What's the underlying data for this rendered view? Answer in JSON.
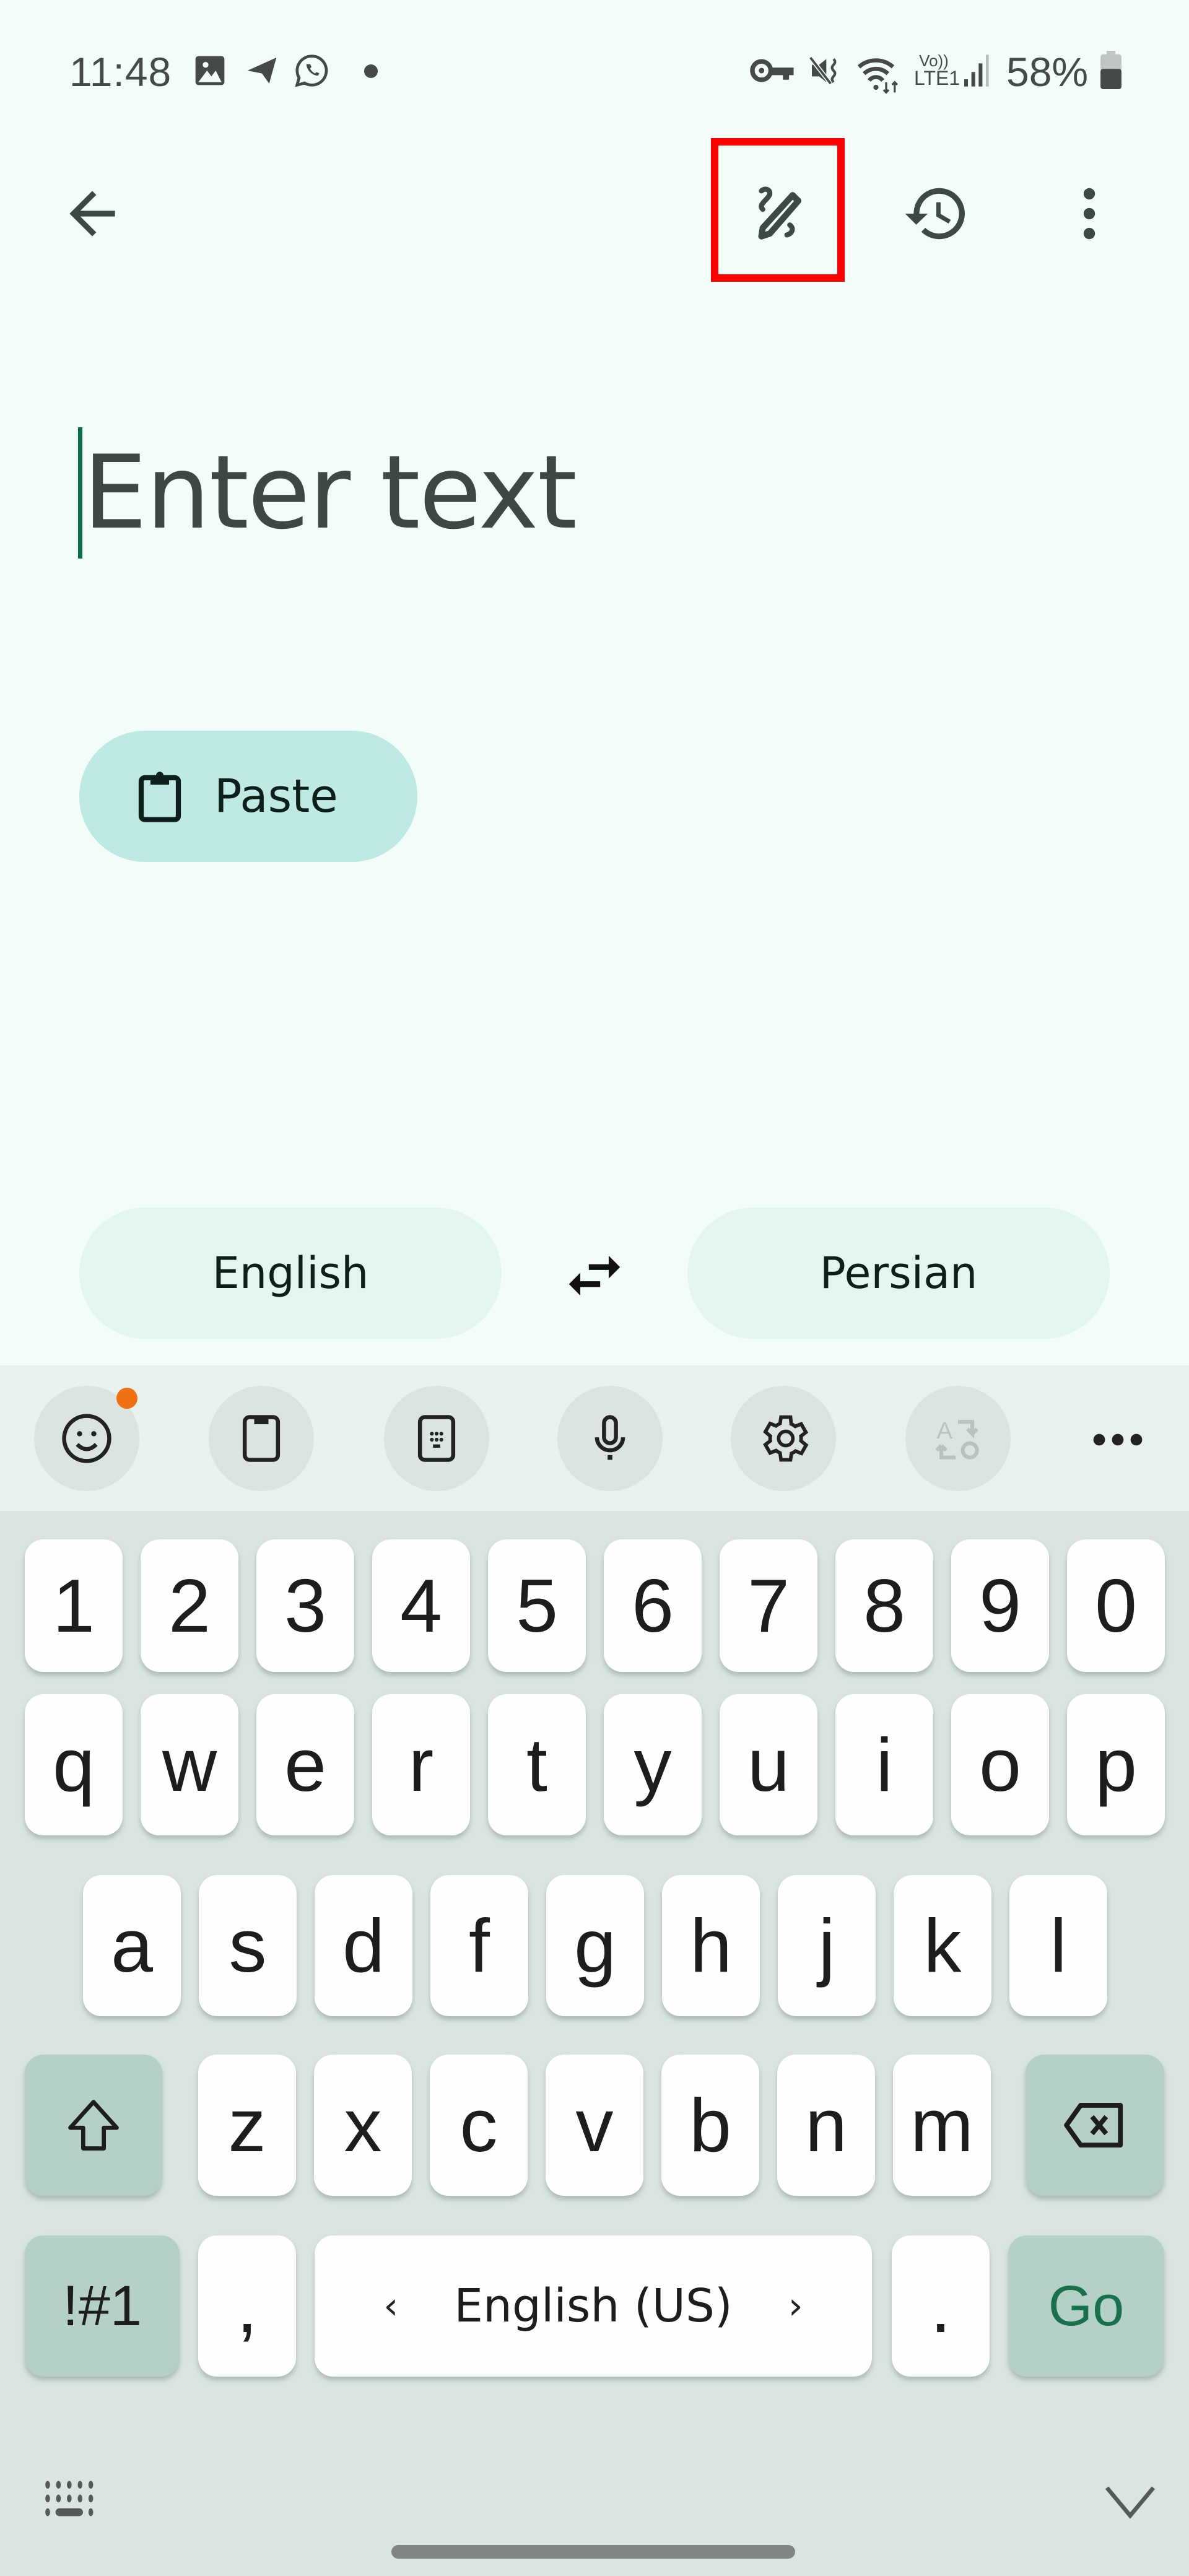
{
  "status_bar": {
    "time": "11:48",
    "left_icons": [
      "gallery-icon",
      "telegram-icon",
      "whatsapp-icon",
      "dot-icon"
    ],
    "right_icons": [
      "vpn-key-icon",
      "mute-vibrate-icon",
      "wifi-icon",
      "volte-lte-icon",
      "signal-icon"
    ],
    "volte_label_top": "Vo))",
    "volte_label_bottom": "LTE1",
    "battery": "58%",
    "battery_level": 0.58
  },
  "app_bar": {
    "back": "back-icon",
    "actions": [
      "handwriting-icon",
      "history-icon",
      "more-vert-icon"
    ],
    "highlighted_action": "handwriting-icon"
  },
  "input": {
    "placeholder": "Enter text",
    "value": ""
  },
  "paste_button": {
    "label": "Paste"
  },
  "languages": {
    "source": "English",
    "target": "Persian"
  },
  "keyboard": {
    "toolbar": [
      "emoji-icon",
      "clipboard-icon",
      "keypad-icon",
      "microphone-icon",
      "settings-icon",
      "translate-icon",
      "more-horiz-icon"
    ],
    "emoji_badge_color": "#f07012",
    "rows": [
      [
        "1",
        "2",
        "3",
        "4",
        "5",
        "6",
        "7",
        "8",
        "9",
        "0"
      ],
      [
        "q",
        "w",
        "e",
        "r",
        "t",
        "y",
        "u",
        "i",
        "o",
        "p"
      ],
      [
        "a",
        "s",
        "d",
        "f",
        "g",
        "h",
        "j",
        "k",
        "l"
      ],
      [
        "z",
        "x",
        "c",
        "v",
        "b",
        "n",
        "m"
      ]
    ],
    "symbols_label": "!#1",
    "comma": ",",
    "space_label": "English (US)",
    "space_left_arrow": "‹",
    "space_right_arrow": "›",
    "period": ".",
    "action_label": "Go",
    "accent_color": "#1a6f4c"
  }
}
